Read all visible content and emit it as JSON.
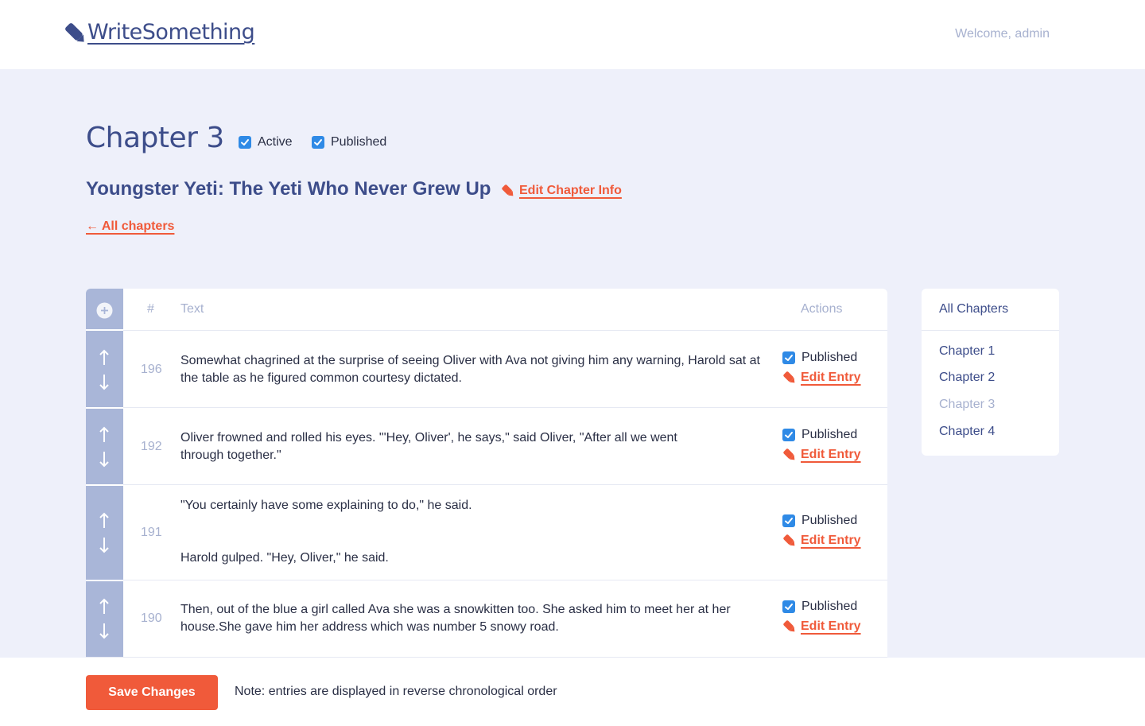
{
  "header": {
    "logo_text": "WriteSomething",
    "welcome": "Welcome, admin"
  },
  "chapter": {
    "title": "Chapter 3",
    "active_label": "Active",
    "active_checked": true,
    "published_label": "Published",
    "published_checked": true,
    "subtitle": "Youngster Yeti: The Yeti Who Never Grew Up",
    "edit_info_label": "Edit Chapter Info",
    "back_label": "← All chapters"
  },
  "table": {
    "headers": {
      "number": "#",
      "text": "Text",
      "actions": "Actions"
    },
    "rows": [
      {
        "number": "196",
        "text": "Somewhat chagrined at the surprise of seeing Oliver with Ava not giving him any warning, Harold sat at the table as he figured common courtesy dictated.",
        "published_label": "Published",
        "published": true,
        "edit_label": "Edit Entry"
      },
      {
        "number": "192",
        "text": "Oliver frowned and rolled his eyes. \"'Hey, Oliver', he says,\" said Oliver, \"After all we went through together.\"",
        "published_label": "Published",
        "published": true,
        "edit_label": "Edit Entry"
      },
      {
        "number": "191",
        "text_lines": [
          "\"You certainly have some explaining to do,\" he said.",
          "Harold gulped. \"Hey, Oliver,\" he said."
        ],
        "published_label": "Published",
        "published": true,
        "edit_label": "Edit Entry"
      },
      {
        "number": "190",
        "text": "Then, out of the blue a girl called Ava she was a snowkitten too. She asked him to meet her at her house.She gave him her address which was number 5 snowy road.",
        "published_label": "Published",
        "published": true,
        "edit_label": "Edit Entry"
      }
    ]
  },
  "sidebar": {
    "heading": "All Chapters",
    "items": [
      {
        "label": "Chapter 1",
        "current": false
      },
      {
        "label": "Chapter 2",
        "current": false
      },
      {
        "label": "Chapter 3",
        "current": true
      },
      {
        "label": "Chapter 4",
        "current": false
      }
    ]
  },
  "footer": {
    "save_label": "Save Changes",
    "note": "Note: entries are displayed in reverse chronological order"
  },
  "colors": {
    "accent": "#f05a3a",
    "primary": "#3d4d8a",
    "muted": "#a7b1cf",
    "rail": "#a9b6d8",
    "checkbox": "#2f8ae6",
    "background": "#eef0fa"
  }
}
